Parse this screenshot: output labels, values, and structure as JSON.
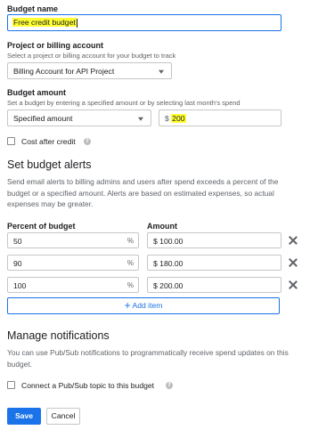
{
  "budget_name": {
    "label": "Budget name",
    "value": "Free credit budget"
  },
  "billing": {
    "label": "Project or billing account",
    "hint": "Select a project or billing account for your budget to track",
    "selected": "Billing Account for API Project"
  },
  "amount": {
    "label": "Budget amount",
    "hint": "Set a budget by entering a specified amount or by selecting last month's spend",
    "type_selected": "Specified amount",
    "currency": "$",
    "value": "200"
  },
  "cost_after_credit": {
    "label": "Cost after credit",
    "checked": false
  },
  "alerts": {
    "title": "Set budget alerts",
    "description": "Send email alerts to billing admins and users after spend exceeds a percent of the budget or a specified amount. Alerts are based on estimated expenses, so actual expenses may be greater.",
    "col_percent": "Percent of budget",
    "col_amount": "Amount",
    "rows": [
      {
        "percent": "50",
        "pct_sign": "%",
        "amount": "$ 100.00"
      },
      {
        "percent": "90",
        "pct_sign": "%",
        "amount": "$ 180.00"
      },
      {
        "percent": "100",
        "pct_sign": "%",
        "amount": "$ 200.00"
      }
    ],
    "add_item": "Add item",
    "add_icon": "+"
  },
  "notifications": {
    "title": "Manage notifications",
    "description": "You can use Pub/Sub notifications to programmatically receive spend updates on this budget.",
    "pubsub_label": "Connect a Pub/Sub topic to this budget",
    "pubsub_checked": false
  },
  "actions": {
    "save": "Save",
    "cancel": "Cancel"
  },
  "colors": {
    "accent": "#1a73e8",
    "highlight": "#ffff33"
  }
}
